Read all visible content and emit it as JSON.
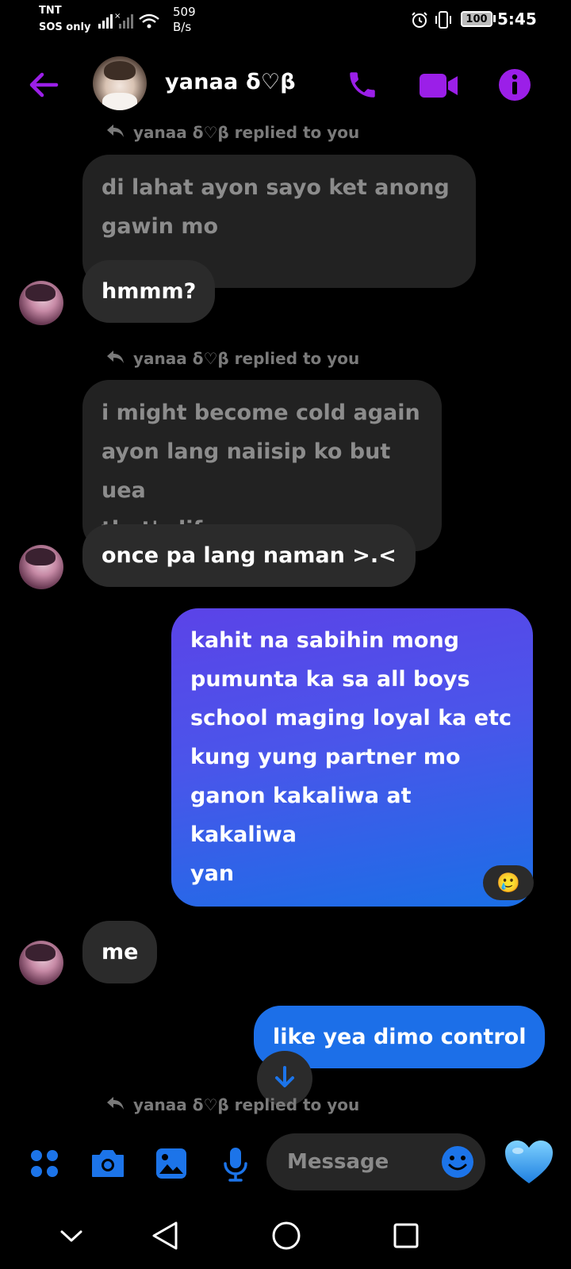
{
  "status_bar": {
    "carrier": "TNT",
    "carrier_status": "SOS only",
    "net_speed_value": "509",
    "net_speed_unit": "B/s",
    "battery": "100",
    "time": "5:45"
  },
  "header": {
    "contact_name": "yanaa δ♡β"
  },
  "messages": [
    {
      "type": "reply_note",
      "text": "yanaa δ♡β replied to you"
    },
    {
      "type": "quoted",
      "lines": [
        "di lahat ayon sayo ket anong",
        "gawin mo"
      ]
    },
    {
      "type": "received",
      "text": "hmmm?"
    },
    {
      "type": "reply_note",
      "text": "yanaa δ♡β replied to you"
    },
    {
      "type": "quoted",
      "lines": [
        "i might become cold again",
        "ayon lang naiisip ko but uea",
        "that's life"
      ]
    },
    {
      "type": "received",
      "text": "once pa lang naman >.<"
    },
    {
      "type": "sent",
      "lines": [
        "kahit na sabihin mong",
        "pumunta ka sa all boys",
        "school maging loyal ka etc",
        "kung yung partner mo",
        "ganon kakaliwa at kakaliwa",
        "yan"
      ],
      "reaction": "🥲"
    },
    {
      "type": "received",
      "text": "me"
    },
    {
      "type": "sent",
      "text": "like yea dimo control"
    },
    {
      "type": "reply_note",
      "text": "yanaa δ♡β replied to you"
    }
  ],
  "composer": {
    "placeholder": "Message"
  },
  "colors": {
    "accent_purple": "#9b1fe8",
    "accent_blue": "#1c74e9",
    "sent_gradient_start": "#5b43e8",
    "sent_gradient_end": "#1a6fe6"
  },
  "icons": [
    "back-arrow-icon",
    "phone-icon",
    "video-icon",
    "info-icon",
    "menu-grid-icon",
    "camera-icon",
    "gallery-icon",
    "mic-icon",
    "emoji-icon",
    "heart-icon",
    "chevron-down-icon",
    "nav-back-icon",
    "nav-home-icon",
    "nav-recents-icon"
  ]
}
